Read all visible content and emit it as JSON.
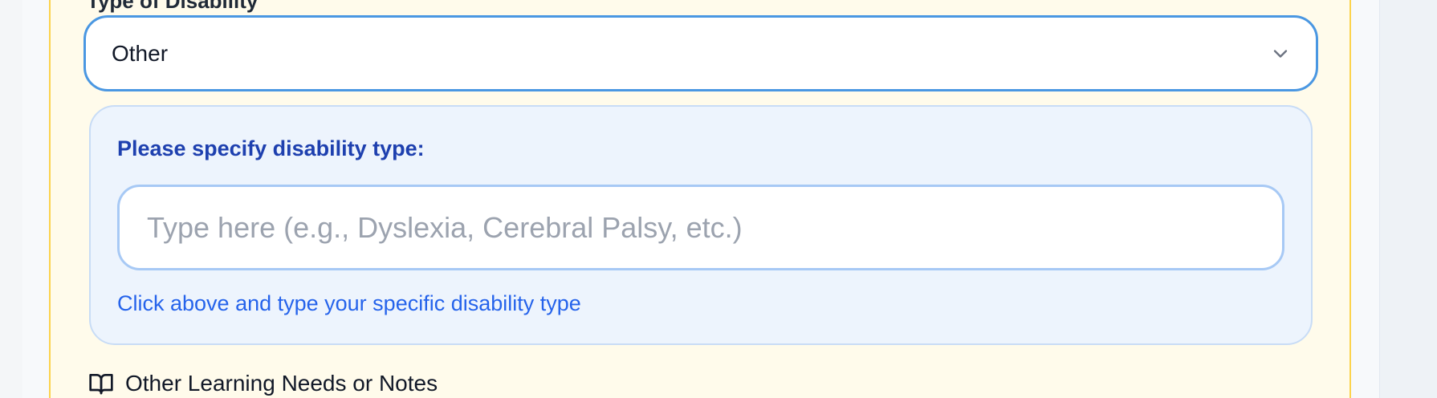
{
  "disability_type": {
    "cut_label": "Type of Disability",
    "selected_value": "Other",
    "icons": {
      "dropdown": "chevron-down-icon"
    }
  },
  "specify": {
    "label": "Please specify disability type:",
    "placeholder": "Type here (e.g., Dyslexia, Cerebral Palsy, etc.)",
    "value": "",
    "hint": "Click above and type your specific disability type"
  },
  "notes_section": {
    "label": "Other Learning Needs or Notes",
    "icon": "book-icon"
  },
  "colors": {
    "section_background": "#fffbeb",
    "section_border": "#fcd34d",
    "select_focus_border": "#4a97e2",
    "specify_panel_background": "#edf4fd",
    "specify_label": "#1e40af",
    "hint_text": "#2563eb"
  }
}
